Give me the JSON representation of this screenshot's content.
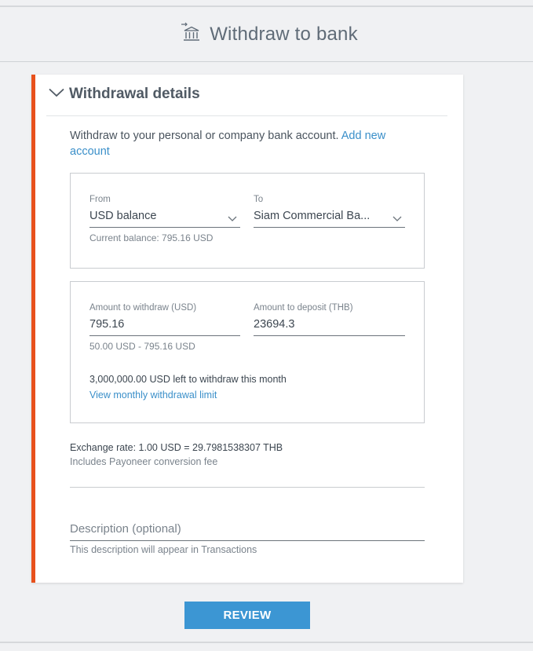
{
  "header": {
    "title": "Withdraw to bank",
    "icon": "bank-transfer-icon"
  },
  "section": {
    "title": "Withdrawal details",
    "icon": "chevron-down-icon"
  },
  "intro": {
    "text": "Withdraw to your personal or company bank account. ",
    "link": "Add new account"
  },
  "from_field": {
    "label": "From",
    "value": "USD balance",
    "hint": "Current balance: 795.16 USD"
  },
  "to_field": {
    "label": "To",
    "value": "Siam Commercial Ba..."
  },
  "amount_field": {
    "label": "Amount to withdraw (USD)",
    "value": "795.16",
    "hint": "50.00 USD - 795.16 USD"
  },
  "deposit_field": {
    "label": "Amount to deposit (THB)",
    "value": "23694.3"
  },
  "limit": {
    "text": "3,000,000.00 USD left to withdraw this month",
    "link": "View monthly withdrawal limit"
  },
  "exchange": {
    "rate": "Exchange rate: 1.00 USD = 29.7981538307 THB",
    "note": "Includes Payoneer conversion fee"
  },
  "description": {
    "placeholder": "Description (optional)",
    "hint": "This description will appear in Transactions"
  },
  "review_button": {
    "label": "REVIEW"
  },
  "colors": {
    "accent": "#e8511c",
    "link": "#3a8fc9",
    "button": "#3c96d3"
  }
}
